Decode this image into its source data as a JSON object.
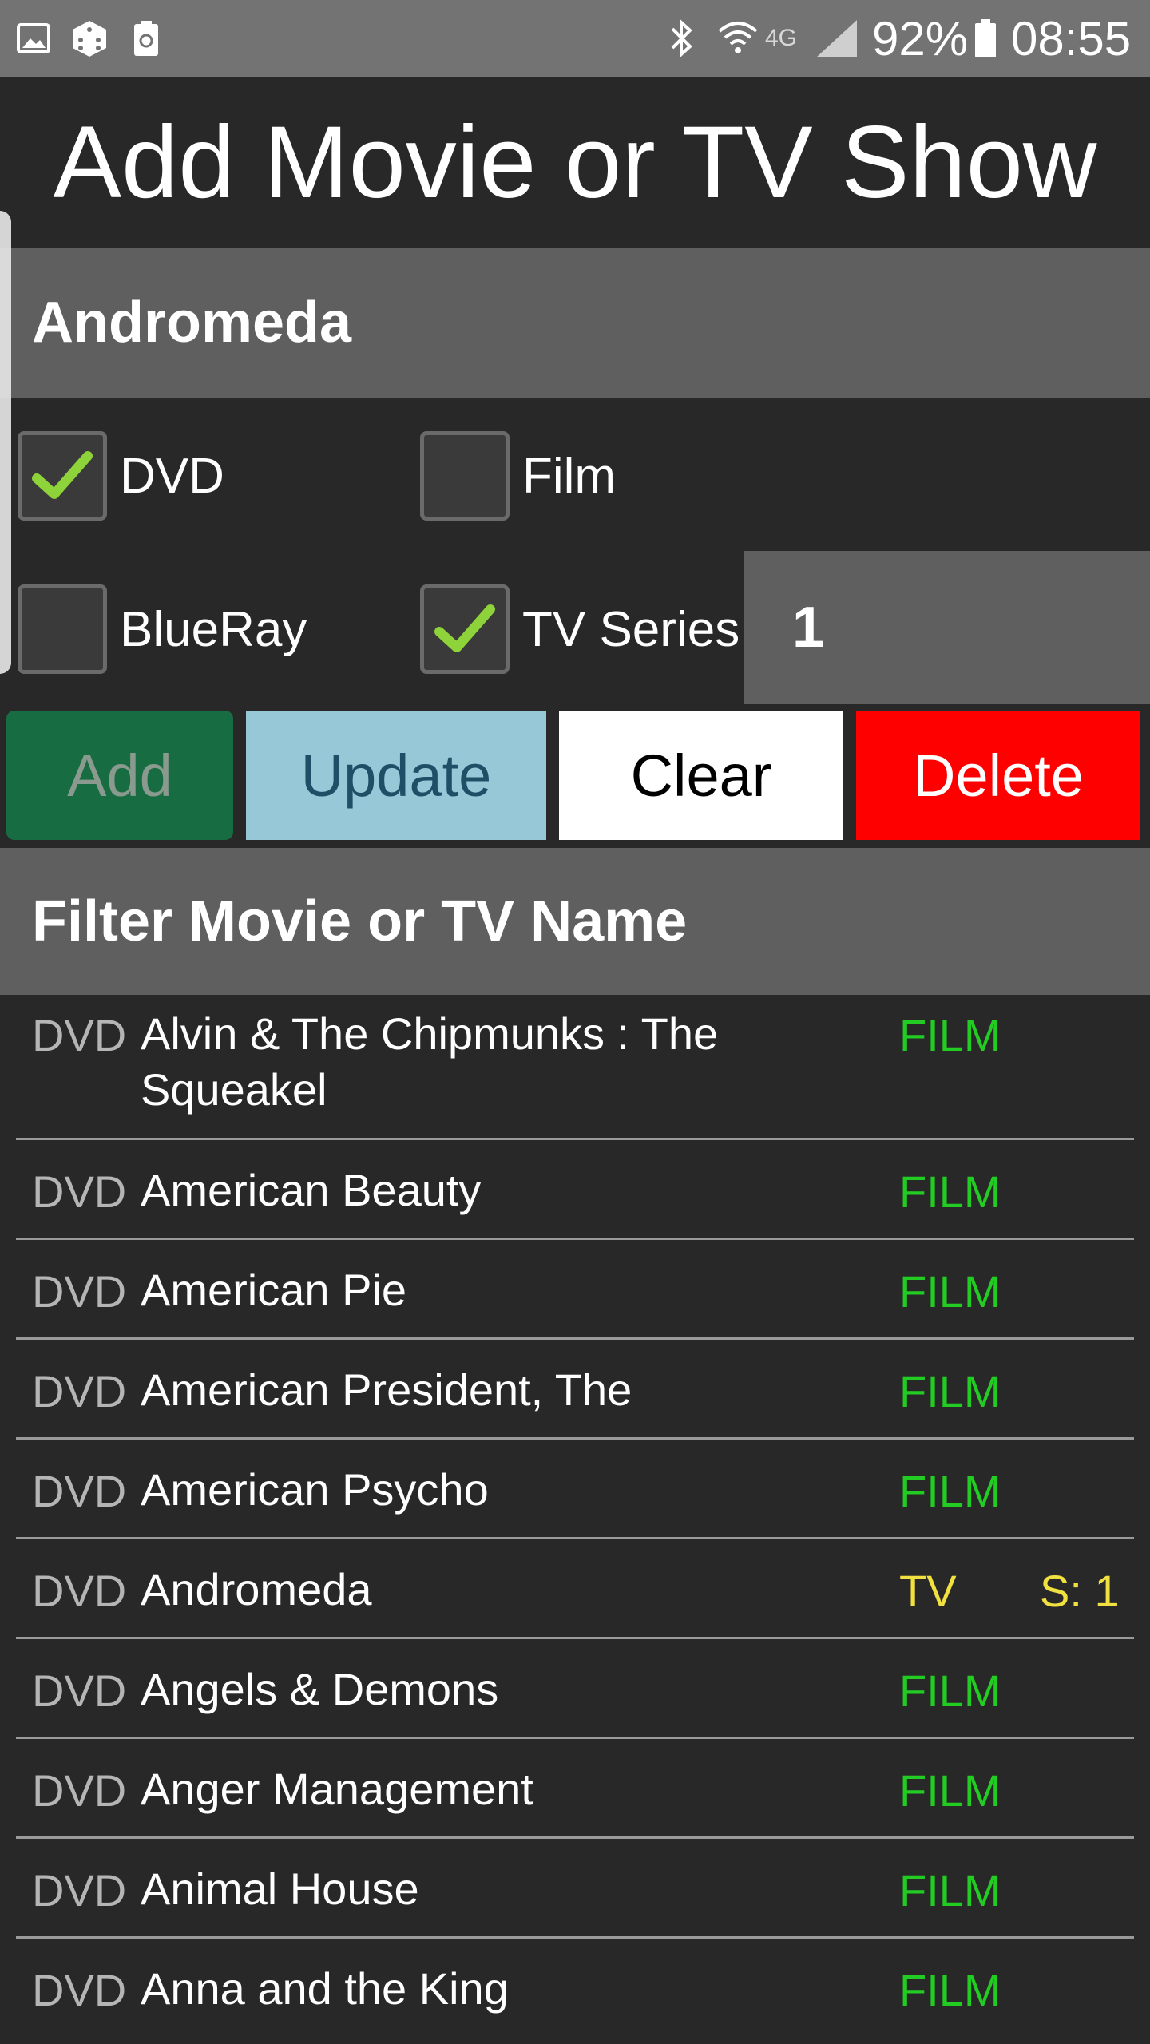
{
  "status_bar": {
    "battery": "92%",
    "time": "08:55",
    "network": "4G"
  },
  "header": {
    "title": "Add Movie or TV Show"
  },
  "name_input": {
    "value": "Andromeda"
  },
  "formats": [
    {
      "label": "DVD",
      "checked": true
    },
    {
      "label": "Film",
      "checked": false
    },
    {
      "label": "BlueRay",
      "checked": false
    },
    {
      "label": "TV Series",
      "checked": true
    }
  ],
  "season_input": {
    "value": "1"
  },
  "buttons": {
    "add": "Add",
    "update": "Update",
    "clear": "Clear",
    "delete": "Delete"
  },
  "filter": {
    "placeholder": "Filter Movie or TV Name"
  },
  "list": [
    {
      "format": "DVD",
      "title": "Alvin & The Chipmunks : The Squeakel",
      "type": "FILM",
      "season": ""
    },
    {
      "format": "DVD",
      "title": "American Beauty",
      "type": "FILM",
      "season": ""
    },
    {
      "format": "DVD",
      "title": "American Pie",
      "type": "FILM",
      "season": ""
    },
    {
      "format": "DVD",
      "title": "American President, The",
      "type": "FILM",
      "season": ""
    },
    {
      "format": "DVD",
      "title": "American Psycho",
      "type": "FILM",
      "season": ""
    },
    {
      "format": "DVD",
      "title": "Andromeda",
      "type": "TV",
      "season": "S: 1"
    },
    {
      "format": "DVD",
      "title": "Angels & Demons",
      "type": "FILM",
      "season": ""
    },
    {
      "format": "DVD",
      "title": "Anger Management",
      "type": "FILM",
      "season": ""
    },
    {
      "format": "DVD",
      "title": "Animal House",
      "type": "FILM",
      "season": ""
    },
    {
      "format": "DVD",
      "title": "Anna and the King",
      "type": "FILM",
      "season": ""
    }
  ],
  "colors": {
    "film": "#22cc22",
    "tv": "#f0e040",
    "add_button": "#176c42",
    "update_button": "#96c8d8",
    "delete_button": "#ff0000"
  }
}
